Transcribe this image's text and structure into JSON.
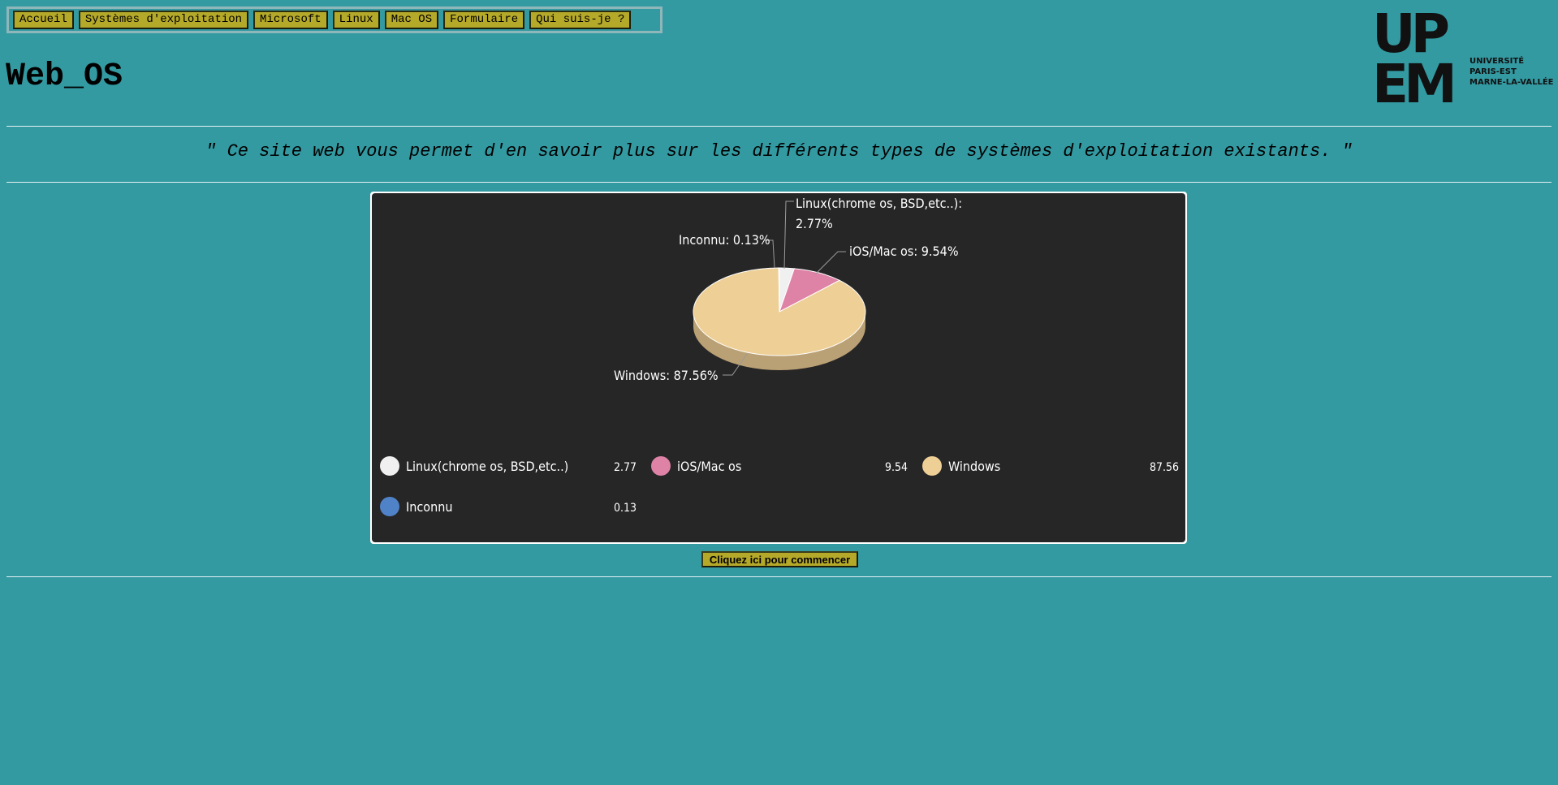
{
  "nav": {
    "items": [
      {
        "label": "Accueil"
      },
      {
        "label": "Systèmes d'exploitation"
      },
      {
        "label": "Microsoft"
      },
      {
        "label": "Linux"
      },
      {
        "label": "Mac OS"
      },
      {
        "label": "Formulaire"
      },
      {
        "label": "Qui suis-je ?"
      }
    ]
  },
  "header": {
    "title": "Web_OS",
    "logo": {
      "letters_top": "UP",
      "letters_bottom": "EM",
      "line1": "UNIVERSITÉ",
      "line2": "PARIS-EST",
      "line3": "MARNE-LA-VALLÉE"
    }
  },
  "tagline": "\" Ce site web vous permet d'en savoir plus sur les différents types de systèmes d'exploitation existants. \"",
  "chart_data": {
    "type": "pie",
    "title": "",
    "slices": [
      {
        "name": "Linux(chrome os, BSD,etc..)",
        "value": 2.77,
        "label": "Linux(chrome os, BSD,etc..): 2.77%",
        "color": "#f0f0f0"
      },
      {
        "name": "iOS/Mac os",
        "value": 9.54,
        "label": "iOS/Mac os: 9.54%",
        "color": "#de82a6"
      },
      {
        "name": "Windows",
        "value": 87.56,
        "label": "Windows: 87.56%",
        "color": "#eecf96"
      },
      {
        "name": "Inconnu",
        "value": 0.13,
        "label": "Inconnu: 0.13%",
        "color": "#5082c8"
      }
    ],
    "legend": [
      {
        "name": "Linux(chrome os, BSD,etc..)",
        "value_text": "2.77",
        "color": "#f0f0f0"
      },
      {
        "name": "iOS/Mac os",
        "value_text": "9.54",
        "color": "#de82a6"
      },
      {
        "name": "Windows",
        "value_text": "87.56",
        "color": "#eecf96"
      },
      {
        "name": "Inconnu",
        "value_text": "0.13",
        "color": "#5082c8"
      }
    ],
    "legend_position": "bottom",
    "background": "#262626"
  },
  "start_button": {
    "label": "Cliquez ici pour commencer"
  },
  "colors": {
    "page_background": "#339aa2",
    "button_background": "#b5a92a"
  }
}
